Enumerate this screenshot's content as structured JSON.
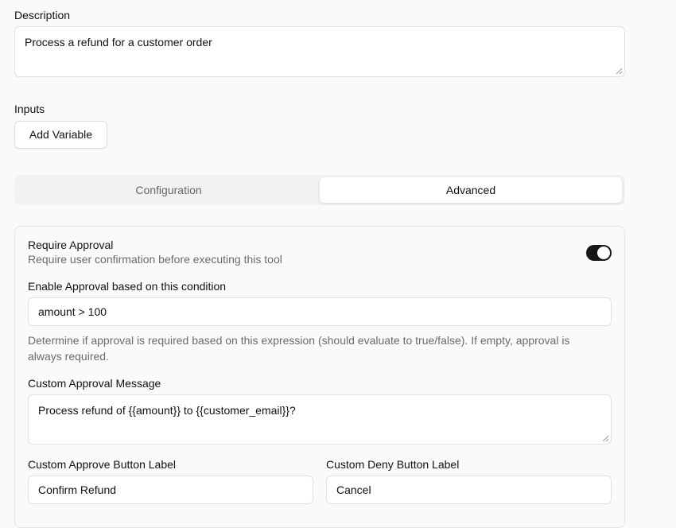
{
  "description": {
    "label": "Description",
    "value": "Process a refund for a customer order"
  },
  "inputs": {
    "label": "Inputs",
    "add_variable_label": "Add Variable"
  },
  "tabs": [
    {
      "label": "Configuration",
      "active": false
    },
    {
      "label": "Advanced",
      "active": true
    }
  ],
  "approval": {
    "require_title": "Require Approval",
    "require_subtitle": "Require user confirmation before executing this tool",
    "require_enabled": true,
    "condition_label": "Enable Approval based on this condition",
    "condition_value": "amount > 100",
    "condition_help_line1": "Determine if approval is required based on this expression (should evaluate to true/false). If empty, approval is",
    "condition_help_line2": "always required.",
    "message_label": "Custom Approval Message",
    "message_value": "Process refund of {{amount}} to {{customer_email}}?",
    "approve_label": "Custom Approve Button Label",
    "approve_value": "Confirm Refund",
    "deny_label": "Custom Deny Button Label",
    "deny_value": "Cancel"
  },
  "colors": {
    "background": "#fafafa",
    "toggle_on": "#171717",
    "muted_text": "#6b6b6b"
  }
}
